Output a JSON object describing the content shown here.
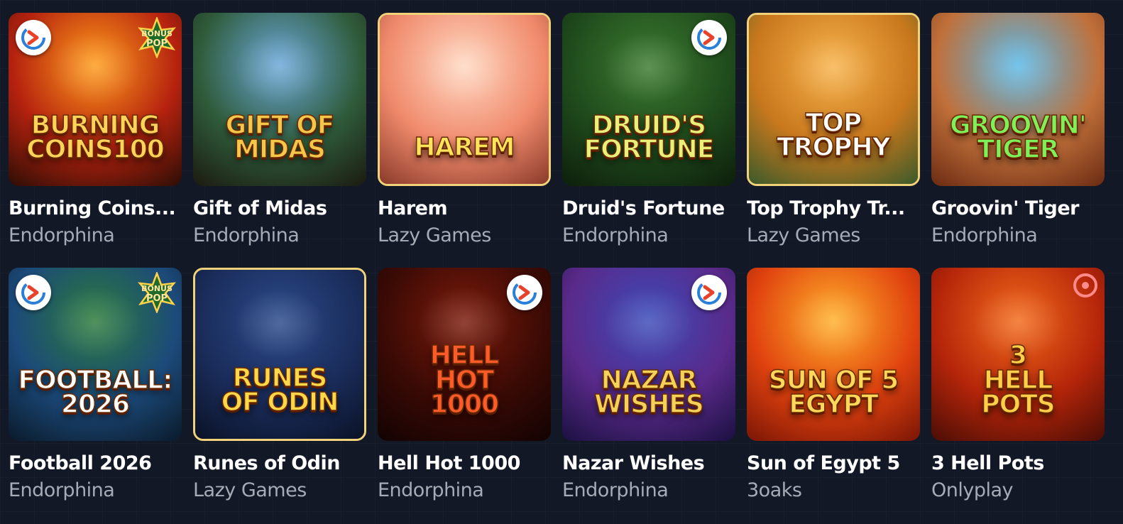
{
  "games": [
    {
      "title": "Burning Coins...",
      "provider": "Endorphina",
      "logo": "BURNING\nCOINS100",
      "bg": [
        "#ff9b1a",
        "#b5220f",
        "#2b0d05"
      ],
      "logo_color": "#ffd35a",
      "badge": "endorphina-left",
      "bonus": true
    },
    {
      "title": "Gift of Midas",
      "provider": "Endorphina",
      "logo": "GIFT OF\nMIDAS",
      "bg": [
        "#6aa7d8",
        "#2f5b3a",
        "#1b1a10"
      ],
      "logo_color": "#f4c64a",
      "badge": "none",
      "bonus": false
    },
    {
      "title": "Harem",
      "provider": "Lazy Games",
      "logo": "HAREM",
      "bg": [
        "#ffd8c2",
        "#f08a6c",
        "#8a3a2a"
      ],
      "logo_color": "#ffe35a",
      "badge": "none",
      "bonus": false,
      "gold_border": true
    },
    {
      "title": "Druid's Fortune",
      "provider": "Endorphina",
      "logo": "DRUID'S\nFORTUNE",
      "bg": [
        "#3b7a2f",
        "#1f4a1c",
        "#0d1e0b"
      ],
      "logo_color": "#e8f07a",
      "badge": "endorphina-right",
      "bonus": false
    },
    {
      "title": "Top Trophy Tr...",
      "provider": "Lazy Games",
      "logo": "TOP\nTROPHY",
      "bg": [
        "#f7b24a",
        "#c9781d",
        "#3a5a2a"
      ],
      "logo_color": "#ffffff",
      "badge": "none",
      "bonus": false,
      "gold_border": true
    },
    {
      "title": "Groovin' Tiger",
      "provider": "Endorphina",
      "logo": "GROOVIN'\nTIGER",
      "bg": [
        "#58b8e8",
        "#c0703a",
        "#6a2a12"
      ],
      "logo_color": "#7ef05a",
      "badge": "none",
      "bonus": false
    },
    {
      "title": "Football 2026",
      "provider": "Endorphina",
      "logo": "FOOTBALL:\n2026",
      "bg": [
        "#2a7a3a",
        "#1c4a7a",
        "#0a1a2a"
      ],
      "logo_color": "#ffffff",
      "badge": "endorphina-left",
      "bonus": true
    },
    {
      "title": "Runes of Odin",
      "provider": "Lazy Games",
      "logo": "RUNES\nOF ODIN",
      "bg": [
        "#2a4a8a",
        "#1a2c5a",
        "#0a1226"
      ],
      "logo_color": "#ffd84a",
      "badge": "none",
      "bonus": false,
      "gold_border": true
    },
    {
      "title": "Hell Hot 1000",
      "provider": "Endorphina",
      "logo": "HELL\nHOT\n1000",
      "bg": [
        "#7a1a0a",
        "#3a0a05",
        "#120302"
      ],
      "logo_color": "#ff5a2a",
      "badge": "endorphina-right",
      "bonus": false
    },
    {
      "title": "Nazar Wishes",
      "provider": "Endorphina",
      "logo": "NAZAR\nWISHES",
      "bg": [
        "#3a4ab8",
        "#5a2a8a",
        "#1a1040"
      ],
      "logo_color": "#f4d25a",
      "badge": "endorphina-right",
      "bonus": false
    },
    {
      "title": "Sun of Egypt 5",
      "provider": "3oaks",
      "logo": "SUN OF 5\nEGYPT",
      "bg": [
        "#ffb02a",
        "#e0420f",
        "#7a1505"
      ],
      "logo_color": "#ffd75a",
      "badge": "none",
      "bonus": false
    },
    {
      "title": "3 Hell Pots",
      "provider": "Onlyplay",
      "logo": "3\nHELL\nPOTS",
      "bg": [
        "#f26a1a",
        "#b5250a",
        "#4a0d05"
      ],
      "logo_color": "#ffcf4a",
      "badge": "target",
      "bonus": false
    }
  ],
  "bonus_badge_text": "BONUS\nPOP"
}
